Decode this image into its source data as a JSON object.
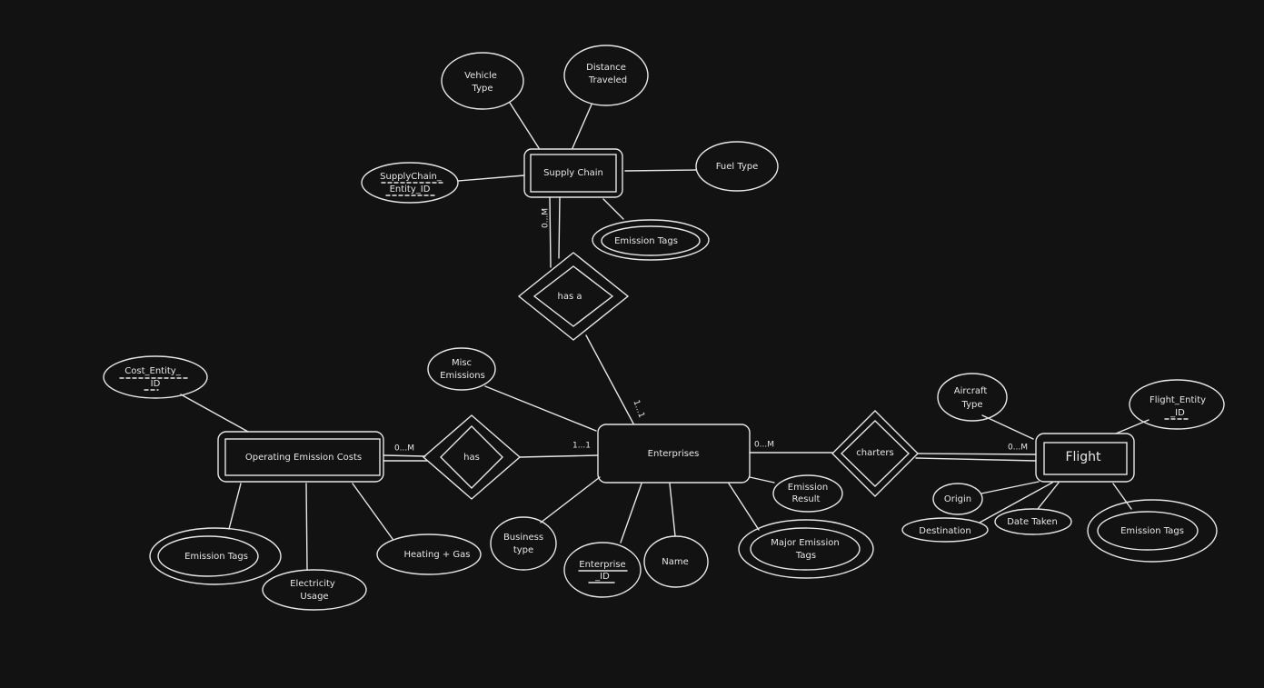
{
  "colors": {
    "background": "#121212",
    "stroke": "#e6e6e6"
  },
  "entities": {
    "supply_chain": "Supply Chain",
    "enterprises": "Enterprises",
    "operating_emission_costs": "Operating Emission Costs",
    "flight": "Flight"
  },
  "relationships": {
    "has_a": "has a",
    "has": "has",
    "charters": "charters"
  },
  "cardinalities": {
    "supply_chain_has_a": "0...M",
    "enterprises_has_a": "1...1",
    "oec_has": "0...M",
    "enterprises_has": "1...1",
    "enterprises_charters": "0...M",
    "flight_charters": "0...M"
  },
  "attributes": {
    "supply_chain": {
      "vehicle_type": [
        "Vehicle",
        "Type"
      ],
      "distance_traveled": [
        "Distance",
        "Traveled"
      ],
      "fuel_type": "Fuel Type",
      "id": [
        "SupplyChain_",
        "Entity_ID"
      ],
      "emission_tags": "Emission Tags"
    },
    "enterprises": {
      "misc_emissions": [
        "Misc",
        "Emissions"
      ],
      "business_type": [
        "Business",
        "type"
      ],
      "id": [
        "Enterprise",
        "_ID"
      ],
      "name": "Name",
      "major_emission_tags": [
        "Major Emission",
        "Tags"
      ],
      "emission_result": [
        "Emission",
        "Result"
      ]
    },
    "oec": {
      "id": [
        "Cost_Entity_",
        "ID"
      ],
      "emission_tags": "Emission Tags",
      "electricity_usage": [
        "Electricity",
        "Usage"
      ],
      "heating_gas": "Heating + Gas"
    },
    "flight": {
      "aircraft_type": [
        "Aircraft",
        "Type"
      ],
      "id": [
        "Flight_Entity",
        "_ID"
      ],
      "origin": "Origin",
      "destination": "Destination",
      "date_taken": "Date Taken",
      "emission_tags": "Emission Tags"
    }
  }
}
